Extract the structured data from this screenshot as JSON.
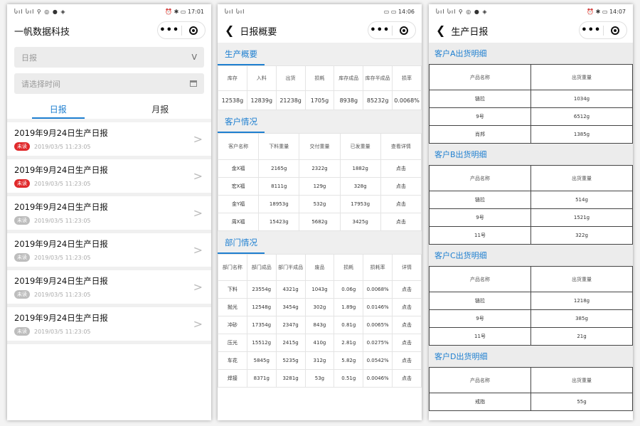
{
  "status_bars": {
    "p1": {
      "signal": "Ⴑıl Ⴑıl ⚲ ◎ ● ◈",
      "right": "⏰ ✱ ▭ 17:01"
    },
    "p2": {
      "signal": "Ⴑıl Ⴑıl",
      "right": "▭ ▭ 14:06"
    },
    "p3": {
      "signal": "Ⴑıl Ⴑıl ⚲ ◎ ● ◈",
      "right": "⏰ ✱ ▭ 14:07"
    }
  },
  "capsule": {
    "more": "•••"
  },
  "home": {
    "title": "一帆数据科技",
    "type_select": "日报",
    "time_placeholder": "请选择时间",
    "tabs": [
      "日报",
      "月报"
    ],
    "reports": [
      {
        "title": "2019年9月24日生产日报",
        "badge": "未读",
        "time": "2019/03/5 11:23:05",
        "badge_color": "#e0292b"
      },
      {
        "title": "2019年9月24日生产日报",
        "badge": "未读",
        "time": "2019/03/5 11:23:05",
        "badge_color": "#e0292b"
      },
      {
        "title": "2019年9月24日生产日报",
        "badge": "未读",
        "time": "2019/03/5 11:23:05",
        "badge_color": "#bdbdbd"
      },
      {
        "title": "2019年9月24日生产日报",
        "badge": "未读",
        "time": "2019/03/5 11:23:05",
        "badge_color": "#bdbdbd"
      },
      {
        "title": "2019年9月24日生产日报",
        "badge": "未读",
        "time": "2019/03/5 11:23:05",
        "badge_color": "#bdbdbd"
      },
      {
        "title": "2019年9月24日生产日报",
        "badge": "未读",
        "time": "2019/03/5 11:23:05",
        "badge_color": "#bdbdbd"
      }
    ]
  },
  "overview": {
    "title": "日报概要",
    "production": {
      "heading": "生产概要",
      "headers": [
        "库存",
        "入料",
        "出货",
        "损耗",
        "库存成品",
        "库存半成品",
        "损率"
      ],
      "row": [
        "12538g",
        "12839g",
        "21238g",
        "1705g",
        "8938g",
        "85232g",
        "0.0068%"
      ]
    },
    "customers": {
      "heading": "客户情况",
      "headers": [
        "客户名称",
        "下料重量",
        "交付重量",
        "已发重量",
        "查看详情"
      ],
      "rows": [
        [
          "金X福",
          "2165g",
          "2322g",
          "1882g",
          "点击"
        ],
        [
          "宏X福",
          "8111g",
          "129g",
          "328g",
          "点击"
        ],
        [
          "金Y福",
          "18953g",
          "532g",
          "17953g",
          "点击"
        ],
        [
          "周X福",
          "15423g",
          "5682g",
          "3425g",
          "点击"
        ]
      ]
    },
    "departments": {
      "heading": "部门情况",
      "headers": [
        "部门名称",
        "部门成品",
        "部门半成品",
        "废品",
        "损耗",
        "损耗率",
        "详情"
      ],
      "rows": [
        [
          "下料",
          "23554g",
          "4321g",
          "1043g",
          "0.06g",
          "0.0068%",
          "点击"
        ],
        [
          "抛光",
          "12548g",
          "3454g",
          "302g",
          "1.89g",
          "0.0146%",
          "点击"
        ],
        [
          "冲砂",
          "17354g",
          "2347g",
          "843g",
          "0.81g",
          "0.0065%",
          "点击"
        ],
        [
          "压光",
          "15512g",
          "2415g",
          "410g",
          "2.81g",
          "0.0275%",
          "点击"
        ],
        [
          "车花",
          "5845g",
          "5235g",
          "312g",
          "5.82g",
          "0.0542%",
          "点击"
        ],
        [
          "焊接",
          "8371g",
          "3281g",
          "53g",
          "0.51g",
          "0.0046%",
          "点击"
        ]
      ]
    }
  },
  "detail": {
    "title": "生产日报",
    "sections": [
      {
        "heading": "客户A出货明细",
        "headers": [
          "产品名称",
          "出货重量"
        ],
        "rows": [
          [
            "链拉",
            "1034g"
          ],
          [
            "9号",
            "6512g"
          ],
          [
            "肖邦",
            "1385g"
          ]
        ]
      },
      {
        "heading": "客户B出货明细",
        "headers": [
          "产品名称",
          "出货重量"
        ],
        "rows": [
          [
            "链拉",
            "514g"
          ],
          [
            "9号",
            "1521g"
          ],
          [
            "11号",
            "322g"
          ]
        ]
      },
      {
        "heading": "客户C出货明细",
        "headers": [
          "产品名称",
          "出货重量"
        ],
        "rows": [
          [
            "链拉",
            "1218g"
          ],
          [
            "9号",
            "385g"
          ],
          [
            "11号",
            "21g"
          ]
        ]
      },
      {
        "heading": "客户D出货明细",
        "headers": [
          "产品名称",
          "出货重量"
        ],
        "rows": [
          [
            "戒指",
            "55g"
          ]
        ]
      }
    ]
  }
}
